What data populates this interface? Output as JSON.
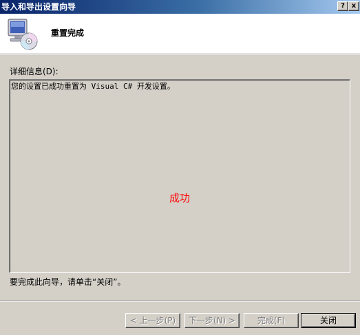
{
  "window": {
    "title": "导入和导出设置向导",
    "help_glyph": "?",
    "close_glyph": "x"
  },
  "header": {
    "title": "重置完成",
    "icon": "computer-cd-icon"
  },
  "details": {
    "label": "详细信息(D):",
    "text": "您的设置已成功重置为 Visual C# 开发设置。",
    "status": "成功",
    "status_color": "#ff0000"
  },
  "footer": {
    "note": "要完成此向导，请单击“关闭”。"
  },
  "buttons": {
    "back": "< 上一步(P)",
    "next": "下一步(N) >",
    "finish": "完成(F)",
    "close": "关闭"
  }
}
